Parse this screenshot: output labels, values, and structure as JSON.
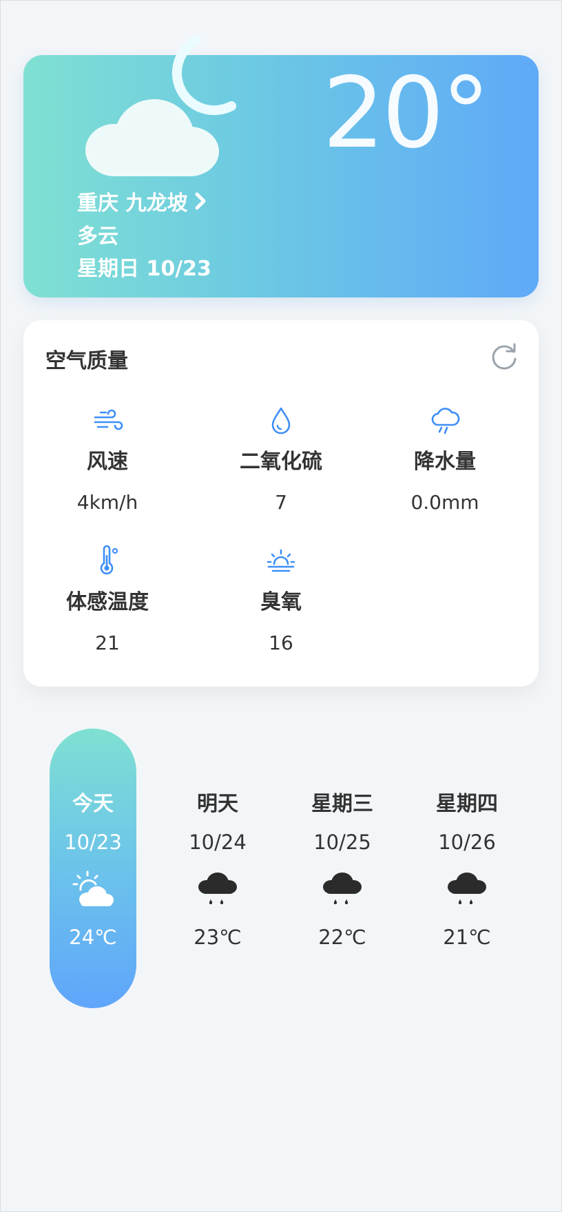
{
  "hero": {
    "temperature": "20°",
    "location": "重庆 九龙坡",
    "condition": "多云",
    "date": "星期日 10/23"
  },
  "air_quality": {
    "title": "空气质量",
    "items": [
      {
        "icon": "wind-icon",
        "label": "风速",
        "value": "4km/h"
      },
      {
        "icon": "water-drop-icon",
        "label": "二氧化硫",
        "value": "7"
      },
      {
        "icon": "rain-cloud-icon",
        "label": "降水量",
        "value": "0.0mm"
      },
      {
        "icon": "thermometer-icon",
        "label": "体感温度",
        "value": "21"
      },
      {
        "icon": "sunrise-icon",
        "label": "臭氧",
        "value": "16"
      }
    ]
  },
  "forecast": [
    {
      "day": "今天",
      "date": "10/23",
      "temp": "24℃",
      "icon": "sun-cloud-icon"
    },
    {
      "day": "明天",
      "date": "10/24",
      "temp": "23℃",
      "icon": "rain-cloud-icon"
    },
    {
      "day": "星期三",
      "date": "10/25",
      "temp": "22℃",
      "icon": "rain-cloud-icon"
    },
    {
      "day": "星期四",
      "date": "10/26",
      "temp": "21℃",
      "icon": "rain-cloud-icon"
    }
  ],
  "colors": {
    "accent_start": "#7fe0d2",
    "accent_end": "#5fa9f8",
    "icon_blue": "#3d8ef7",
    "text_dark": "#333333"
  }
}
